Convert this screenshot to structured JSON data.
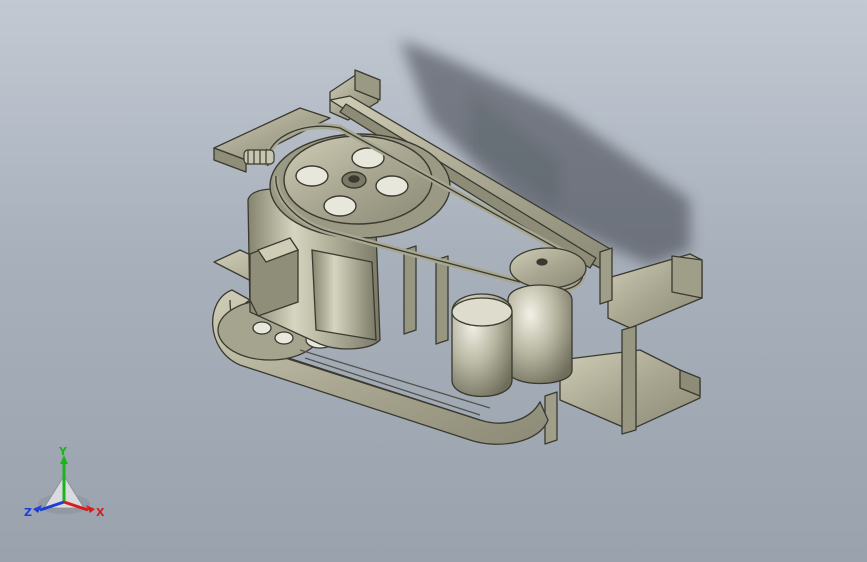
{
  "viewport": {
    "background_top": "#c2c9d3",
    "background_bottom": "#9aa2ad",
    "model_color": "#b9b8a2",
    "edge_color": "#3a3a30"
  },
  "triad": {
    "x_label": "X",
    "y_label": "Y",
    "z_label": "Z",
    "x_color": "#d41e1e",
    "y_color": "#1bb51b",
    "z_color": "#1e3fd4"
  }
}
